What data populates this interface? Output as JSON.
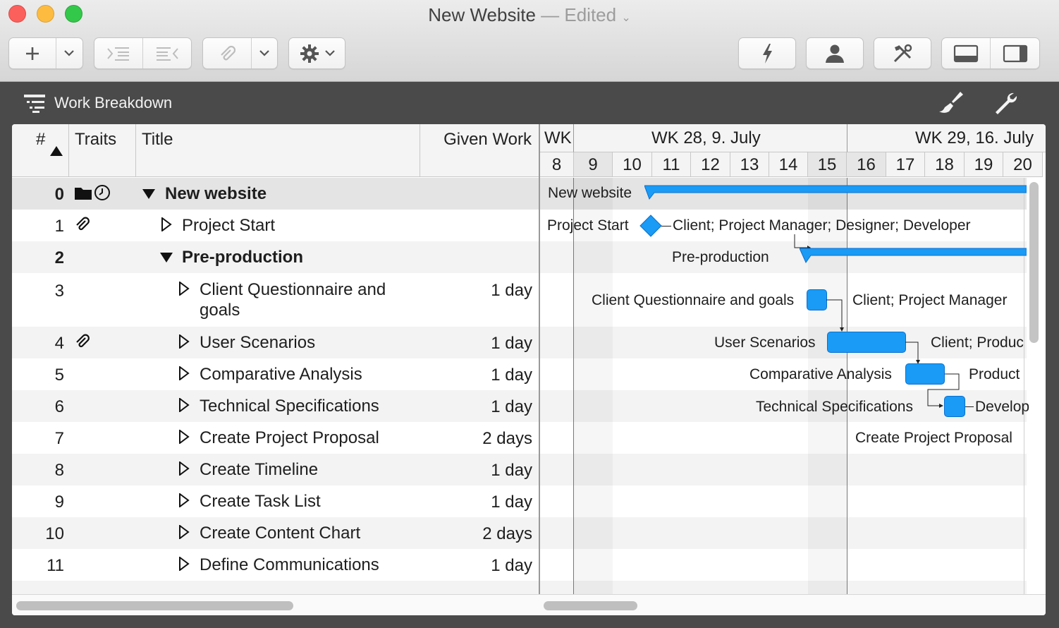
{
  "window": {
    "title": "New Website",
    "title_status": "— Edited"
  },
  "toolbar": {
    "add_icon": "plus-icon",
    "indent_icon": "indent-icon",
    "outdent_icon": "outdent-icon",
    "attach_icon": "paperclip-icon",
    "settings_icon": "gear-icon",
    "level_icon": "lightning-icon",
    "resources_icon": "person-icon",
    "tools_icon": "tools-icon",
    "bottom_pane_icon": "bottom-pane-icon",
    "side_pane_icon": "side-pane-icon"
  },
  "section": {
    "title": "Work Breakdown"
  },
  "outline": {
    "columns": {
      "number": "#",
      "traits": "Traits",
      "title": "Title",
      "given_work": "Given Work"
    },
    "rows": [
      {
        "num": "0",
        "title": "New website",
        "work": "",
        "bold": true
      },
      {
        "num": "1",
        "title": "Project Start",
        "work": ""
      },
      {
        "num": "2",
        "title": "Pre-production",
        "work": "",
        "bold": true
      },
      {
        "num": "3",
        "title": "Client Questionnaire and goals",
        "work": "1 day"
      },
      {
        "num": "4",
        "title": "User Scenarios",
        "work": "1 day"
      },
      {
        "num": "5",
        "title": "Comparative Analysis",
        "work": "1 day"
      },
      {
        "num": "6",
        "title": "Technical Specifications",
        "work": "1 day"
      },
      {
        "num": "7",
        "title": "Create Project Proposal",
        "work": "2 days"
      },
      {
        "num": "8",
        "title": "Create Timeline",
        "work": "1 day"
      },
      {
        "num": "9",
        "title": "Create Task List",
        "work": "1 day"
      },
      {
        "num": "10",
        "title": "Create Content Chart",
        "work": "2 days"
      },
      {
        "num": "11",
        "title": "Define Communications",
        "work": "1 day"
      }
    ]
  },
  "gantt": {
    "weeks": [
      "WK",
      "WK 28, 9. July",
      "WK 29, 16. July"
    ],
    "days": [
      "8",
      "9",
      "10",
      "11",
      "12",
      "13",
      "14",
      "15",
      "16",
      "17",
      "18",
      "19",
      "20"
    ],
    "labels": {
      "r0": "New website",
      "r1": "Project Start",
      "r1_resources": "Client; Project Manager; Designer; Developer",
      "r2": "Pre-production",
      "r3": "Client Questionnaire and goals",
      "r3_resources": "Client; Project Manager",
      "r4": "User Scenarios",
      "r4_resources": "Client; Produc",
      "r5": "Comparative Analysis",
      "r5_resources": "Product",
      "r6": "Technical Specifications",
      "r6_resources": "Develop",
      "r7": "Create Project Proposal"
    }
  },
  "colors": {
    "bar": "#1a9bf5",
    "bar_border": "#0a6fd1"
  }
}
